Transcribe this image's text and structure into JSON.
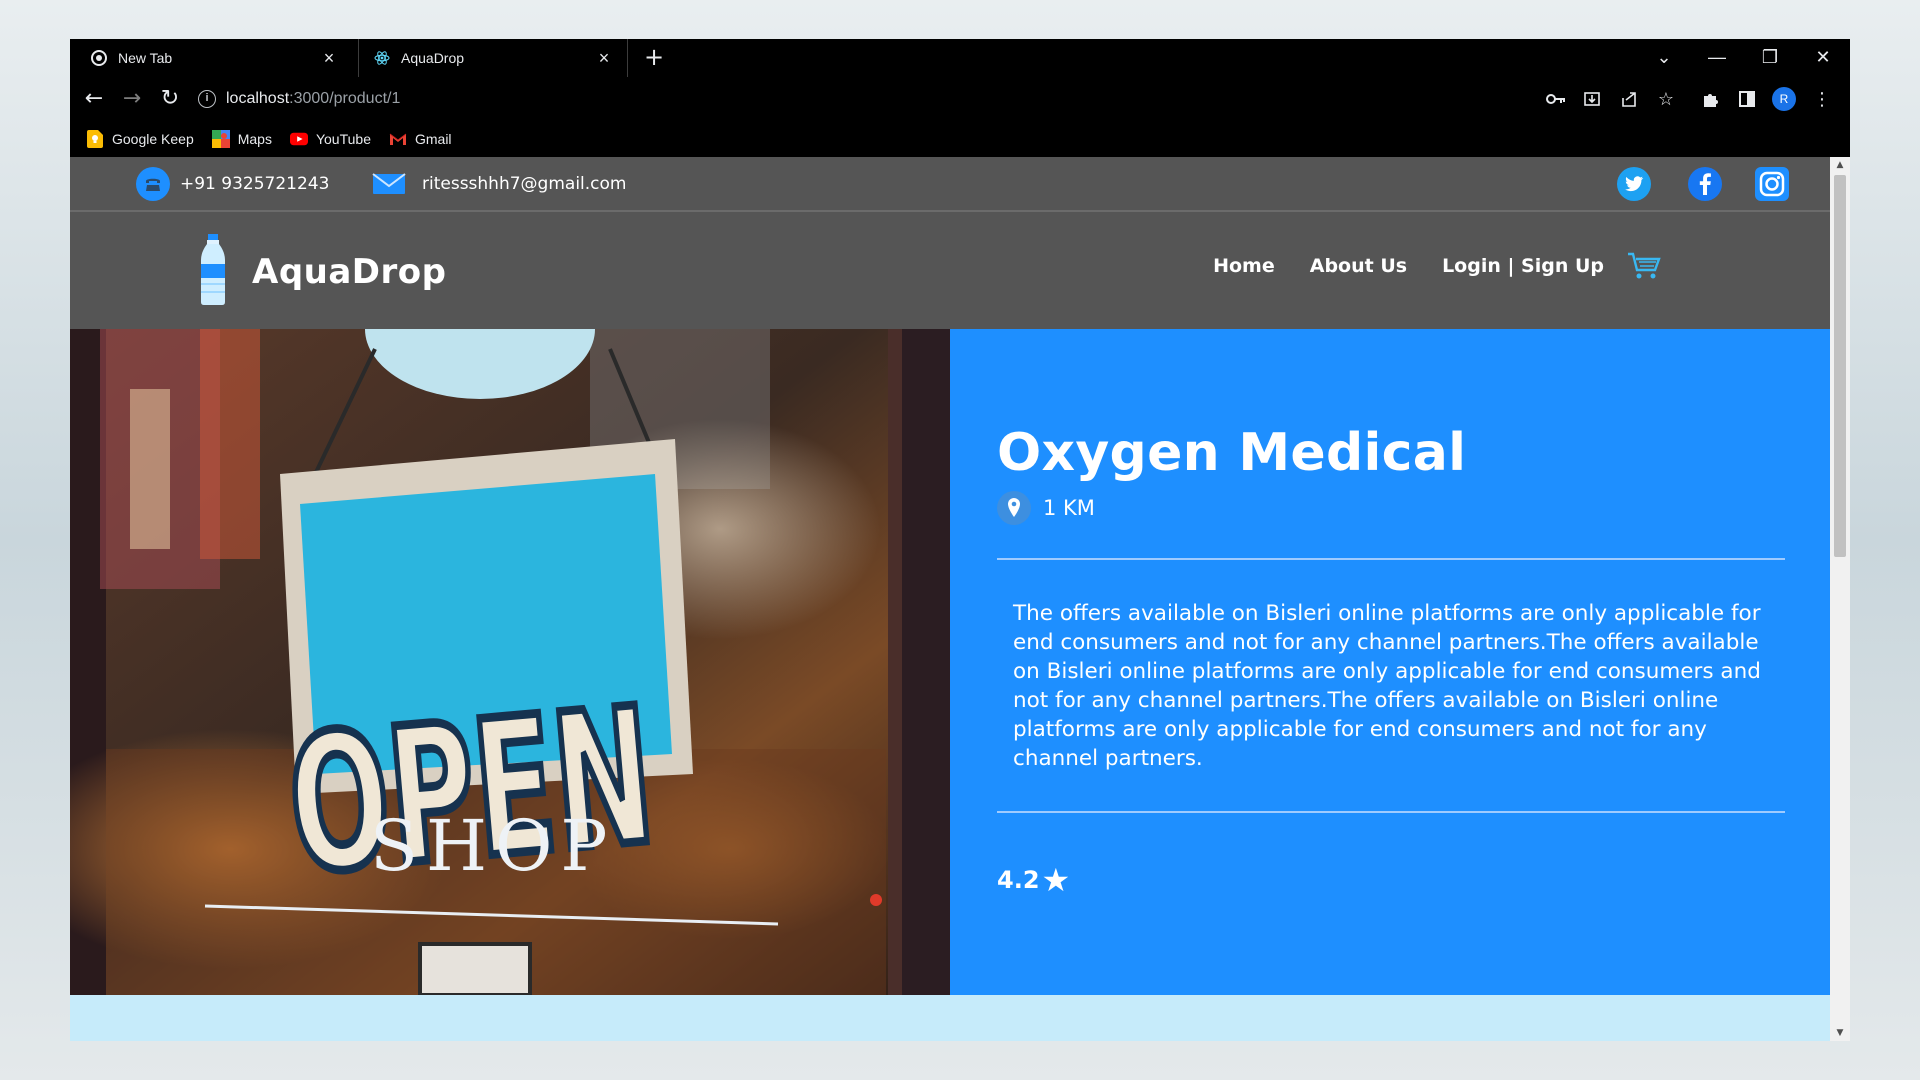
{
  "browser": {
    "tabs": [
      {
        "title": "New Tab"
      },
      {
        "title": "AquaDrop"
      }
    ],
    "new_tab_label": "+",
    "window_controls": {
      "chevron": "⌄",
      "minimize": "—",
      "restore": "❐",
      "close": "✕"
    },
    "url": {
      "host": "localhost",
      "path": ":3000/product/1"
    },
    "bookmarks": [
      {
        "label": "Google Keep",
        "icon": "keep-icon"
      },
      {
        "label": "Maps",
        "icon": "maps-icon"
      },
      {
        "label": "YouTube",
        "icon": "youtube-icon"
      },
      {
        "label": "Gmail",
        "icon": "gmail-icon"
      }
    ],
    "profile_initial": "R"
  },
  "topbar": {
    "phone": "+91 9325721243",
    "email": "ritessshhh7@gmail.com",
    "social": [
      "twitter-icon",
      "facebook-icon",
      "instagram-icon"
    ]
  },
  "navbar": {
    "brand": "AquaDrop",
    "links": {
      "home": "Home",
      "about": "About Us",
      "login": "Login | Sign Up"
    }
  },
  "product": {
    "name": "Oxygen Medical",
    "distance": "1 KM",
    "description": "The offers available on Bisleri online platforms are only applicable for end consumers and not for any channel partners.The offers available on Bisleri online platforms are only applicable for end consumers and not for any channel partners.The offers available on Bisleri online platforms are only applicable for end consumers and not for any channel partners.",
    "rating": "4.2",
    "rating_star": "★"
  },
  "hero_image": {
    "sign_text": "OPEN",
    "sign_subtext": "SHOP"
  },
  "colors": {
    "panel": "#1e8fff",
    "header": "#555555",
    "footer_strip": "#c6ebfa"
  }
}
